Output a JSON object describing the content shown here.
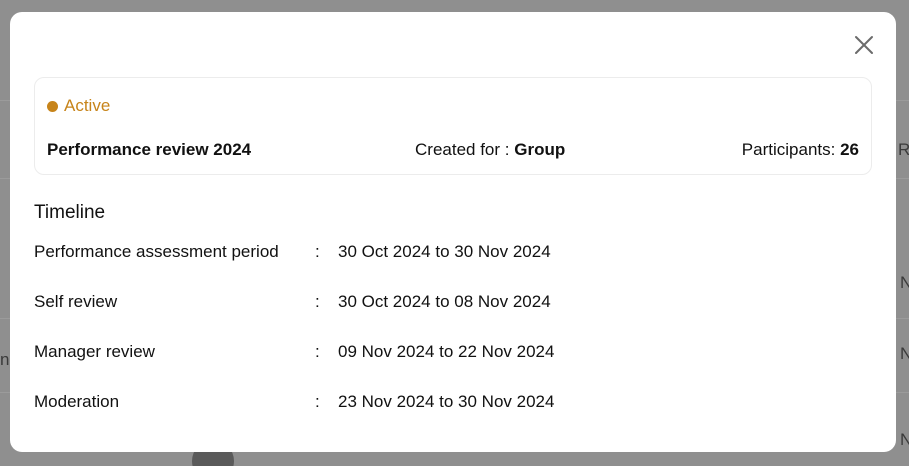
{
  "background": {
    "edge_chars_right": [
      "R",
      "N",
      "N",
      "N"
    ],
    "edge_chars_left": [
      "n"
    ]
  },
  "card": {
    "status": "Active",
    "status_color": "#c7841a",
    "review_name": "Performance review 2024",
    "created_for_label": "Created for :",
    "created_for_value": "Group",
    "participants_label": "Participants:",
    "participants_value": "26"
  },
  "timeline": {
    "title": "Timeline",
    "rows": [
      {
        "label": "Performance assessment period",
        "colon": ":",
        "value": "30 Oct 2024 to 30 Nov 2024"
      },
      {
        "label": "Self review",
        "colon": ":",
        "value": "30 Oct 2024 to 08 Nov 2024"
      },
      {
        "label": "Manager review",
        "colon": ":",
        "value": "09 Nov 2024 to 22 Nov 2024"
      },
      {
        "label": "Moderation",
        "colon": ":",
        "value": "23 Nov 2024 to 30 Nov 2024"
      }
    ]
  },
  "icons": {
    "close": "close-icon"
  }
}
